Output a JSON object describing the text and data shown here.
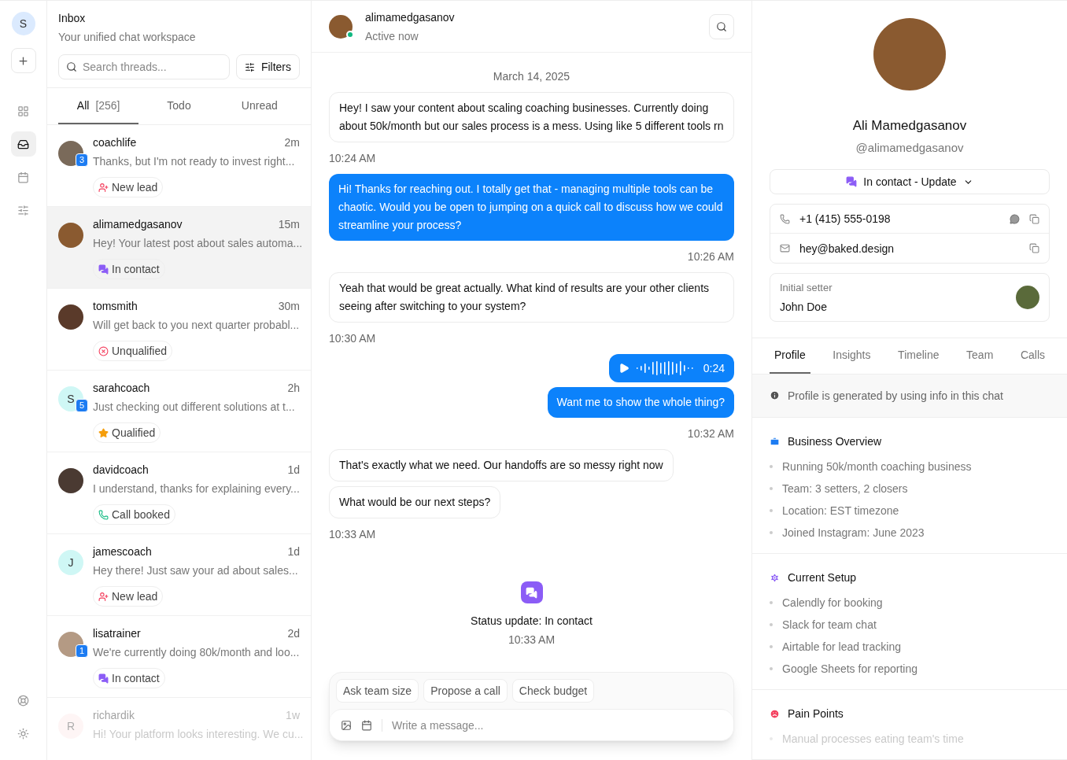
{
  "rail": {
    "avatar": "S",
    "top_items": [
      {
        "selected": false
      },
      {
        "selected": true
      },
      {
        "selected": false
      },
      {
        "selected": false
      }
    ],
    "bottom_items": [
      {
        "selected": false
      },
      {
        "selected": false
      }
    ]
  },
  "inbox": {
    "title": "Inbox",
    "subtitle": "Your unified chat workspace",
    "search": {
      "placeholder": "Search threads..."
    },
    "filters": "Filters",
    "tabs": [
      {
        "label": "All",
        "count": "[256]",
        "selected": true
      },
      {
        "label": "Todo",
        "selected": false
      },
      {
        "label": "Unread",
        "selected": false
      }
    ],
    "threads": [
      {
        "name": "coachlife",
        "time": "2m",
        "preview": "Thanks, but I'm not ready to invest right...",
        "avatar": {
          "kind": "photo",
          "color": "#7a6a5a"
        },
        "unread": "3",
        "tag": {
          "kind": "new_lead",
          "label": "New lead"
        },
        "selected": false,
        "faded": false
      },
      {
        "name": "alimamedgasanov",
        "time": "15m",
        "preview": "Hey! Your latest post about sales automa...",
        "avatar": {
          "kind": "photo",
          "color": "#8a5a30"
        },
        "tag": {
          "kind": "in_contact",
          "label": "In contact"
        },
        "selected": true,
        "faded": false
      },
      {
        "name": "tomsmith",
        "time": "30m",
        "preview": "Will get back to you next quarter probabl...",
        "avatar": {
          "kind": "photo",
          "color": "#5a3a2a"
        },
        "tag": {
          "kind": "unqualified",
          "label": "Unqualified"
        },
        "selected": false,
        "faded": false
      },
      {
        "name": "sarahcoach",
        "time": "2h",
        "preview": "Just checking out different solutions at t...",
        "avatar": {
          "kind": "initial",
          "initial": "S",
          "color": "#cff7f5"
        },
        "unread": "5",
        "tag": {
          "kind": "qualified",
          "label": "Qualified"
        },
        "selected": false,
        "faded": false
      },
      {
        "name": "davidcoach",
        "time": "1d",
        "preview": "I understand, thanks for explaining every...",
        "avatar": {
          "kind": "photo",
          "color": "#4a3a32"
        },
        "tag": {
          "kind": "call_booked",
          "label": "Call booked"
        },
        "selected": false,
        "faded": false
      },
      {
        "name": "jamescoach",
        "time": "1d",
        "preview": "Hey there! Just saw your ad about sales...",
        "avatar": {
          "kind": "initial",
          "initial": "J",
          "color": "#cff7f5"
        },
        "tag": {
          "kind": "new_lead",
          "label": "New lead"
        },
        "selected": false,
        "faded": false
      },
      {
        "name": "lisatrainer",
        "time": "2d",
        "preview": "We're currently doing 80k/month and loo...",
        "avatar": {
          "kind": "photo",
          "color": "#b49a84"
        },
        "unread": "1",
        "tag": {
          "kind": "in_contact",
          "label": "In contact"
        },
        "selected": false,
        "faded": false
      },
      {
        "name": "richardik",
        "time": "1w",
        "preview": "Hi! Your platform looks interesting. We cu...",
        "avatar": {
          "kind": "initial",
          "initial": "R",
          "color": "#fde8e8"
        },
        "selected": false,
        "faded": true
      }
    ]
  },
  "chat": {
    "contact": {
      "name": "alimamedgasanov",
      "status": "Active now",
      "online": true
    },
    "items": [
      {
        "kind": "date",
        "text": "March 14, 2025"
      },
      {
        "kind": "incoming",
        "text": "Hey! I saw your content about scaling coaching businesses. Currently doing about 50k/month but our sales process is a mess. Using like 5 different tools rn"
      },
      {
        "kind": "received_time",
        "text": "10:24 AM"
      },
      {
        "kind": "outgoing",
        "text": "Hi! Thanks for reaching out. I totally get that - managing multiple tools can be chaotic. Would you be open to jumping on a quick call to discuss how we could streamline your process?"
      },
      {
        "kind": "sent_time",
        "text": "10:26 AM"
      },
      {
        "kind": "incoming",
        "text": "Yeah that would be great actually. What kind of results are your other clients seeing after switching to your system?"
      },
      {
        "kind": "received_time",
        "text": "10:30 AM"
      },
      {
        "kind": "voice",
        "text": "0:24"
      },
      {
        "kind": "outgoing",
        "text": "Want me to show the whole thing?"
      },
      {
        "kind": "sent_time",
        "text": "10:32 AM"
      },
      {
        "kind": "incoming",
        "text": "That's exactly what we need. Our handoffs are so messy right now"
      },
      {
        "kind": "incoming",
        "text": "What would be our next steps?"
      },
      {
        "kind": "received_time",
        "text": "10:33 AM"
      },
      {
        "kind": "status",
        "text": "Status update: In contact",
        "time": "10:33 AM"
      }
    ],
    "suggestions": [
      "Ask team size",
      "Propose a call",
      "Check budget"
    ],
    "composer": {
      "placeholder": "Write a message..."
    }
  },
  "profile": {
    "name": "Ali Mamedgasanov",
    "handle": "@alimamedgasanov",
    "status_button": "In contact - Update",
    "phone": "+1 (415) 555-0198",
    "email": "hey@baked.design",
    "setter": {
      "label": "Initial setter",
      "name": "John Doe"
    },
    "tabs": [
      {
        "label": "Profile",
        "selected": true
      },
      {
        "label": "Insights",
        "selected": false
      },
      {
        "label": "Timeline",
        "selected": false
      },
      {
        "label": "Team",
        "selected": false
      },
      {
        "label": "Calls",
        "selected": false
      }
    ],
    "note": "Profile is generated by using info in this chat",
    "sections": [
      {
        "color": "#1d7cf2",
        "title": "Business Overview",
        "items": [
          "Running 50k/month coaching business",
          "Team: 3 setters, 2 closers",
          "Location: EST timezone",
          "Joined Instagram: June 2023"
        ],
        "faded": false
      },
      {
        "color": "#8b5cf6",
        "title": "Current Setup",
        "items": [
          "Calendly for booking",
          "Slack for team chat",
          "Airtable for lead tracking",
          "Google Sheets for reporting"
        ],
        "faded": false
      },
      {
        "color": "#f43f5e",
        "title": "Pain Points",
        "items": [
          "Manual processes eating team's time"
        ],
        "faded": true
      }
    ]
  }
}
